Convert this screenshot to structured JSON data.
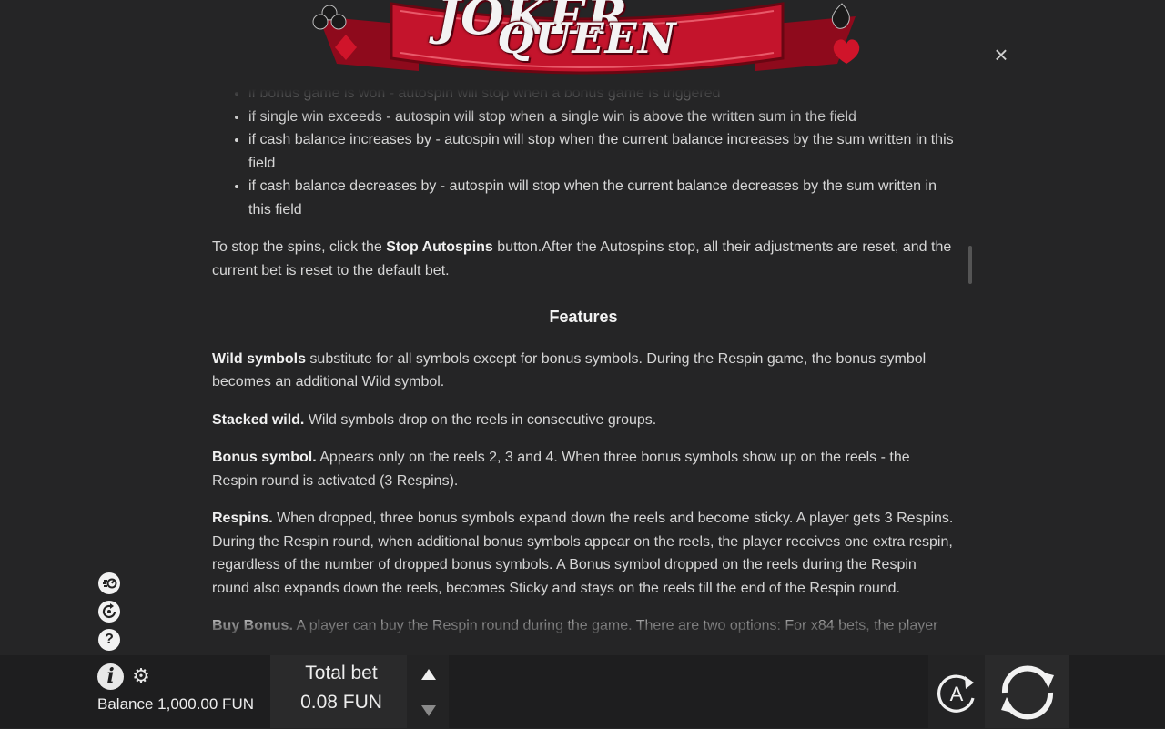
{
  "logo": {
    "line1": "JOKER",
    "line2": "QUEEN"
  },
  "close_label": "×",
  "autospin_bullets": [
    "if bonus game is won - autospin will stop when a bonus game is triggered",
    "if single win exceeds - autospin will stop when a single win is above the written sum in the field",
    "if cash balance increases by - autospin will stop when the current balance increases by the sum written in this field",
    "if cash balance decreases by - autospin will stop when the current balance decreases by the sum written in this field"
  ],
  "stop_paragraph": {
    "before": "To stop the spins, click the ",
    "bold": "Stop Autospins",
    "after": " button.After the Autospins stop, all their adjustments are reset, and the current bet is reset to the default bet."
  },
  "features_title": "Features",
  "features": [
    {
      "term": "Wild symbols",
      "text": " substitute for all symbols except for bonus symbols. During the Respin game, the bonus symbol becomes an additional Wild symbol."
    },
    {
      "term": "Stacked wild.",
      "text": " Wild symbols drop on the reels in consecutive groups."
    },
    {
      "term": "Bonus symbol.",
      "text": " Appears only on the reels 2, 3 and 4. When three bonus symbols show up on the reels - the Respin round is activated (3 Respins)."
    },
    {
      "term": "Respins.",
      "text": " When dropped, three bonus symbols expand down the reels and become sticky. A player gets 3 Respins. During the Respin round, when additional bonus symbols appear on the reels, the player receives one extra respin, regardless of the number of dropped bonus symbols. A Bonus symbol dropped on the reels during the Respin round also expands down the reels, becomes Sticky and stays on the reels till the end of the Respin round."
    },
    {
      "term": "Buy Bonus.",
      "text": " A player can buy the Respin round during the game. There are two options: For x84 bets, the player"
    }
  ],
  "side_icons": [
    "turbo-icon",
    "history-icon",
    "help-icon"
  ],
  "help_glyph": "?",
  "info_glyph": "i",
  "gear_glyph": "⚙",
  "balance_text": "Balance 1,000.00 FUN",
  "total_bet_label": "Total bet",
  "total_bet_value": "0.08 FUN",
  "autoplay_letter": "A"
}
